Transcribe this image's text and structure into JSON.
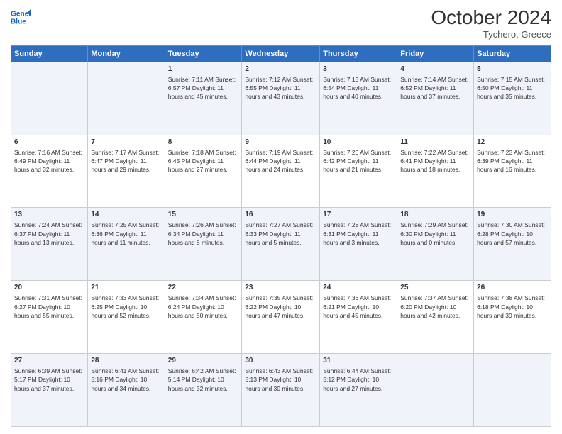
{
  "header": {
    "logo_line1": "General",
    "logo_line2": "Blue",
    "month_title": "October 2024",
    "subtitle": "Tychero, Greece"
  },
  "weekdays": [
    "Sunday",
    "Monday",
    "Tuesday",
    "Wednesday",
    "Thursday",
    "Friday",
    "Saturday"
  ],
  "weeks": [
    [
      {
        "day": "",
        "info": ""
      },
      {
        "day": "",
        "info": ""
      },
      {
        "day": "1",
        "info": "Sunrise: 7:11 AM\nSunset: 6:57 PM\nDaylight: 11 hours and 45 minutes."
      },
      {
        "day": "2",
        "info": "Sunrise: 7:12 AM\nSunset: 6:55 PM\nDaylight: 11 hours and 43 minutes."
      },
      {
        "day": "3",
        "info": "Sunrise: 7:13 AM\nSunset: 6:54 PM\nDaylight: 11 hours and 40 minutes."
      },
      {
        "day": "4",
        "info": "Sunrise: 7:14 AM\nSunset: 6:52 PM\nDaylight: 11 hours and 37 minutes."
      },
      {
        "day": "5",
        "info": "Sunrise: 7:15 AM\nSunset: 6:50 PM\nDaylight: 11 hours and 35 minutes."
      }
    ],
    [
      {
        "day": "6",
        "info": "Sunrise: 7:16 AM\nSunset: 6:49 PM\nDaylight: 11 hours and 32 minutes."
      },
      {
        "day": "7",
        "info": "Sunrise: 7:17 AM\nSunset: 6:47 PM\nDaylight: 11 hours and 29 minutes."
      },
      {
        "day": "8",
        "info": "Sunrise: 7:18 AM\nSunset: 6:45 PM\nDaylight: 11 hours and 27 minutes."
      },
      {
        "day": "9",
        "info": "Sunrise: 7:19 AM\nSunset: 6:44 PM\nDaylight: 11 hours and 24 minutes."
      },
      {
        "day": "10",
        "info": "Sunrise: 7:20 AM\nSunset: 6:42 PM\nDaylight: 11 hours and 21 minutes."
      },
      {
        "day": "11",
        "info": "Sunrise: 7:22 AM\nSunset: 6:41 PM\nDaylight: 11 hours and 18 minutes."
      },
      {
        "day": "12",
        "info": "Sunrise: 7:23 AM\nSunset: 6:39 PM\nDaylight: 11 hours and 16 minutes."
      }
    ],
    [
      {
        "day": "13",
        "info": "Sunrise: 7:24 AM\nSunset: 6:37 PM\nDaylight: 11 hours and 13 minutes."
      },
      {
        "day": "14",
        "info": "Sunrise: 7:25 AM\nSunset: 6:36 PM\nDaylight: 11 hours and 11 minutes."
      },
      {
        "day": "15",
        "info": "Sunrise: 7:26 AM\nSunset: 6:34 PM\nDaylight: 11 hours and 8 minutes."
      },
      {
        "day": "16",
        "info": "Sunrise: 7:27 AM\nSunset: 6:33 PM\nDaylight: 11 hours and 5 minutes."
      },
      {
        "day": "17",
        "info": "Sunrise: 7:28 AM\nSunset: 6:31 PM\nDaylight: 11 hours and 3 minutes."
      },
      {
        "day": "18",
        "info": "Sunrise: 7:29 AM\nSunset: 6:30 PM\nDaylight: 11 hours and 0 minutes."
      },
      {
        "day": "19",
        "info": "Sunrise: 7:30 AM\nSunset: 6:28 PM\nDaylight: 10 hours and 57 minutes."
      }
    ],
    [
      {
        "day": "20",
        "info": "Sunrise: 7:31 AM\nSunset: 6:27 PM\nDaylight: 10 hours and 55 minutes."
      },
      {
        "day": "21",
        "info": "Sunrise: 7:33 AM\nSunset: 6:25 PM\nDaylight: 10 hours and 52 minutes."
      },
      {
        "day": "22",
        "info": "Sunrise: 7:34 AM\nSunset: 6:24 PM\nDaylight: 10 hours and 50 minutes."
      },
      {
        "day": "23",
        "info": "Sunrise: 7:35 AM\nSunset: 6:22 PM\nDaylight: 10 hours and 47 minutes."
      },
      {
        "day": "24",
        "info": "Sunrise: 7:36 AM\nSunset: 6:21 PM\nDaylight: 10 hours and 45 minutes."
      },
      {
        "day": "25",
        "info": "Sunrise: 7:37 AM\nSunset: 6:20 PM\nDaylight: 10 hours and 42 minutes."
      },
      {
        "day": "26",
        "info": "Sunrise: 7:38 AM\nSunset: 6:18 PM\nDaylight: 10 hours and 39 minutes."
      }
    ],
    [
      {
        "day": "27",
        "info": "Sunrise: 6:39 AM\nSunset: 5:17 PM\nDaylight: 10 hours and 37 minutes."
      },
      {
        "day": "28",
        "info": "Sunrise: 6:41 AM\nSunset: 5:16 PM\nDaylight: 10 hours and 34 minutes."
      },
      {
        "day": "29",
        "info": "Sunrise: 6:42 AM\nSunset: 5:14 PM\nDaylight: 10 hours and 32 minutes."
      },
      {
        "day": "30",
        "info": "Sunrise: 6:43 AM\nSunset: 5:13 PM\nDaylight: 10 hours and 30 minutes."
      },
      {
        "day": "31",
        "info": "Sunrise: 6:44 AM\nSunset: 5:12 PM\nDaylight: 10 hours and 27 minutes."
      },
      {
        "day": "",
        "info": ""
      },
      {
        "day": "",
        "info": ""
      }
    ]
  ]
}
